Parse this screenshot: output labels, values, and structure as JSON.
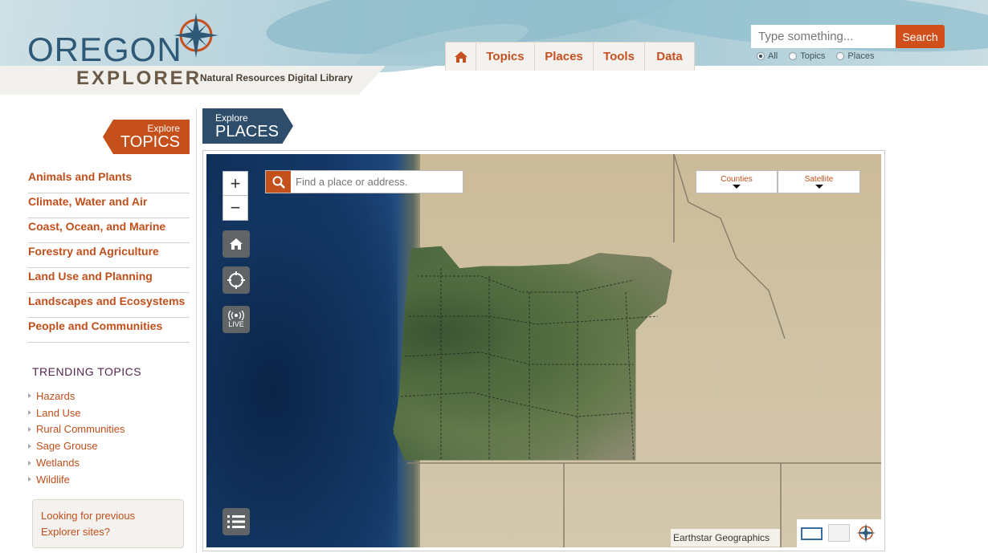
{
  "header": {
    "logo_oregon": "OREGON",
    "logo_explorer": "EXPLORER",
    "logo_subtitle": "Natural Resources Digital Library",
    "nav": [
      {
        "label": "Topics"
      },
      {
        "label": "Places"
      },
      {
        "label": "Tools"
      },
      {
        "label": "Data"
      }
    ],
    "search": {
      "placeholder": "Type something...",
      "button_label": "Search",
      "options": [
        "All",
        "Topics",
        "Places"
      ],
      "selected": "All"
    }
  },
  "sidebar": {
    "badge_small": "Explore",
    "badge_big": "TOPICS",
    "categories": [
      "Animals and Plants",
      "Climate, Water and Air",
      "Coast, Ocean, and Marine",
      "Forestry and Agriculture",
      "Land Use and Planning",
      "Landscapes and Ecosystems",
      "People and Communities"
    ],
    "trending_title": "TRENDING TOPICS",
    "trending": [
      "Hazards",
      "Land Use",
      "Rural Communities",
      "Sage Grouse",
      "Wetlands",
      "Wildlife"
    ],
    "previous_box": "Looking for previous Explorer sites?"
  },
  "places": {
    "badge_small": "Explore",
    "badge_big": "PLACES"
  },
  "map": {
    "search_placeholder": "Find a place or address.",
    "zoom_in": "+",
    "zoom_out": "−",
    "live_label": "LIVE",
    "layer_dropdown": "Counties",
    "basemap_dropdown": "Satellite",
    "attribution": "Earthstar Geographics"
  },
  "colors": {
    "accent": "#c4511f",
    "navy": "#2e4d6b"
  }
}
